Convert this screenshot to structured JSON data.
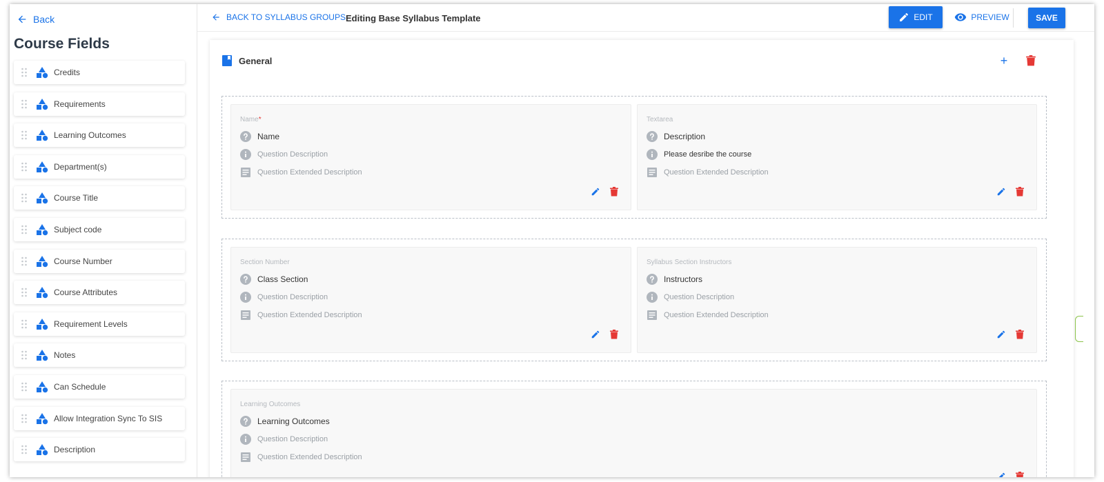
{
  "sidebar": {
    "back_label": "Back",
    "title": "Course Fields",
    "items": [
      {
        "label": "Credits"
      },
      {
        "label": "Requirements"
      },
      {
        "label": "Learning Outcomes"
      },
      {
        "label": "Department(s)"
      },
      {
        "label": "Course Title"
      },
      {
        "label": "Subject code"
      },
      {
        "label": "Course Number"
      },
      {
        "label": "Course Attributes"
      },
      {
        "label": "Requirement Levels"
      },
      {
        "label": "Notes"
      },
      {
        "label": "Can Schedule"
      },
      {
        "label": "Allow Integration Sync To SIS"
      },
      {
        "label": "Description"
      }
    ]
  },
  "topbar": {
    "back_label": "BACK TO SYLLABUS GROUPS",
    "editing_title": "Editing Base Syllabus Template",
    "edit_label": "EDIT",
    "preview_label": "PREVIEW",
    "save_label": "SAVE"
  },
  "section": {
    "title": "General",
    "add_symbol": "+"
  },
  "cards": [
    {
      "type": "Name",
      "required_mark": "*",
      "question": "Name",
      "description": "Question Description",
      "extended": "Question Extended Description"
    },
    {
      "type": "Textarea",
      "required_mark": "",
      "question": "Description",
      "description": "Please desribe the course",
      "extended": "Question Extended Description"
    },
    {
      "type": "Section Number",
      "required_mark": "",
      "question": "Class Section",
      "description": "Question Description",
      "extended": "Question Extended Description"
    },
    {
      "type": "Syllabus Section Instructors",
      "required_mark": "",
      "question": "Instructors",
      "description": "Question Description",
      "extended": "Question Extended Description"
    },
    {
      "type": "Learning Outcomes",
      "required_mark": "",
      "question": "Learning Outcomes",
      "description": "Question Description",
      "extended": "Question Extended Description"
    }
  ],
  "colors": {
    "primary": "#1a73e8",
    "danger": "#e53935",
    "muted_icon": "#b0b6bd"
  },
  "icons": {
    "back": "arrow-left-icon",
    "drag": "drag-handle-icon",
    "field": "shapes-icon",
    "edit": "pencil-icon",
    "preview": "eye-icon",
    "section": "bookmark-icon",
    "delete": "trash-icon",
    "question": "help-circle-icon",
    "description": "info-icon",
    "extended": "notes-icon"
  }
}
